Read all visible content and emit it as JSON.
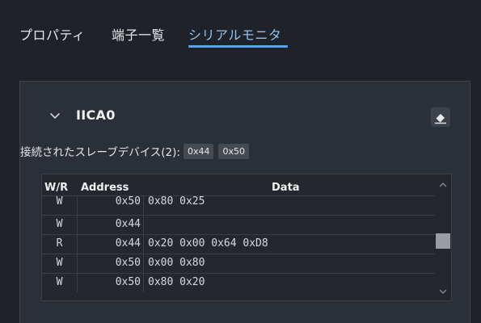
{
  "tabs": [
    {
      "label": "プロパティ",
      "active": false
    },
    {
      "label": "端子一覧",
      "active": false
    },
    {
      "label": "シリアルモニタ",
      "active": true
    }
  ],
  "section": {
    "title": "IICA0",
    "collapse_icon": "chevron-down-icon",
    "clear_icon": "eraser-icon"
  },
  "connected": {
    "label": "接続されたスレーブデバイス(2):",
    "addresses": [
      "0x44",
      "0x50"
    ]
  },
  "table": {
    "headers": {
      "wr": "W/R",
      "address": "Address",
      "data": "Data"
    },
    "rows": [
      {
        "wr": "W",
        "address": "0x50",
        "data": "0x80 0x25"
      },
      {
        "wr": "W",
        "address": "0x44",
        "data": ""
      },
      {
        "wr": "R",
        "address": "0x44",
        "data": "0x20 0x00 0x64 0xD8"
      },
      {
        "wr": "W",
        "address": "0x50",
        "data": "0x00 0x80"
      },
      {
        "wr": "W",
        "address": "0x50",
        "data": "0x80 0x20"
      }
    ]
  },
  "colors": {
    "background": "#1f2229",
    "panel": "#2b2f37",
    "active_tab": "#5aa4ee",
    "chip": "#454a53"
  }
}
